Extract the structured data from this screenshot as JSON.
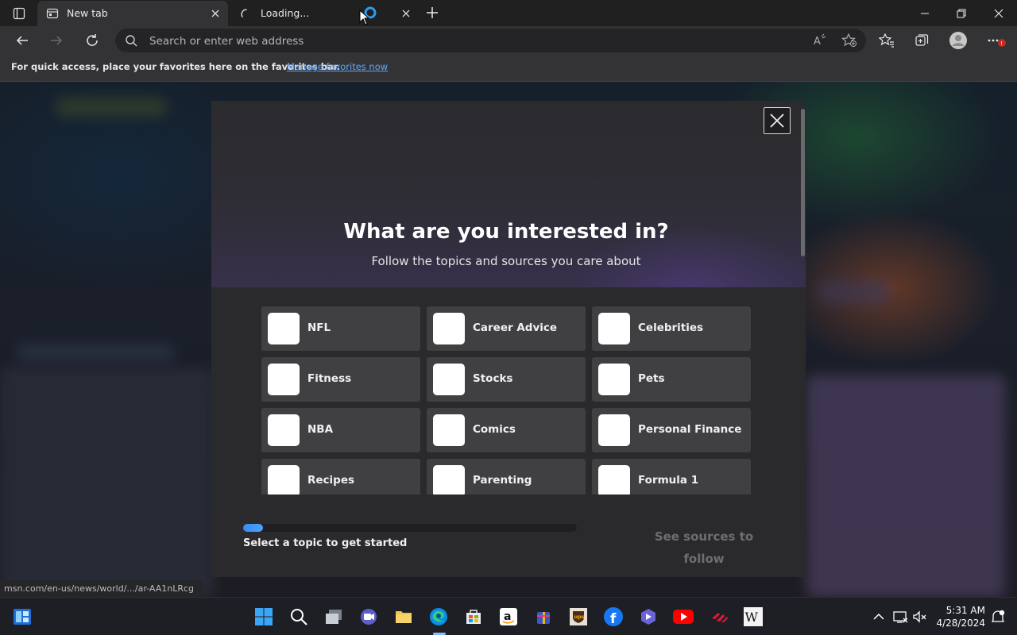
{
  "browser": {
    "tabs": [
      {
        "title": "New tab",
        "state": "active"
      },
      {
        "title": "Loading...",
        "state": "loading"
      }
    ],
    "address": {
      "placeholder": "Search or enter web address"
    },
    "favorites_bar": {
      "message": "For quick access, place your favorites here on the favorites bar.",
      "link": "Manage favorites now"
    },
    "status_url": "msn.com/en-us/news/world/.../ar-AA1nLRcg"
  },
  "modal": {
    "title": "What are you interested in?",
    "subtitle": "Follow the topics and sources you care about",
    "topics": [
      "NFL",
      "Career Advice",
      "Celebrities",
      "Fitness",
      "Stocks",
      "Pets",
      "NBA",
      "Comics",
      "Personal Finance",
      "Recipes",
      "Parenting",
      "Formula 1"
    ],
    "progress_hint": "Select a topic to get started",
    "progress_fraction": 0.06,
    "next_button": "See sources to follow"
  },
  "taskbar": {
    "apps": [
      "start-icon",
      "search-icon",
      "file-explorer-icon",
      "teams-icon",
      "folder-icon",
      "edge-icon",
      "store-icon",
      "amazon-icon",
      "gift-icon",
      "ups-icon",
      "facebook-icon",
      "copilot-icon",
      "youtube-icon",
      "bank-icon",
      "wikipedia-icon"
    ],
    "time": "5:31 AM",
    "date": "4/28/2024"
  },
  "colors": {
    "accent": "#4aa3ff",
    "link": "#5ca8ff"
  }
}
